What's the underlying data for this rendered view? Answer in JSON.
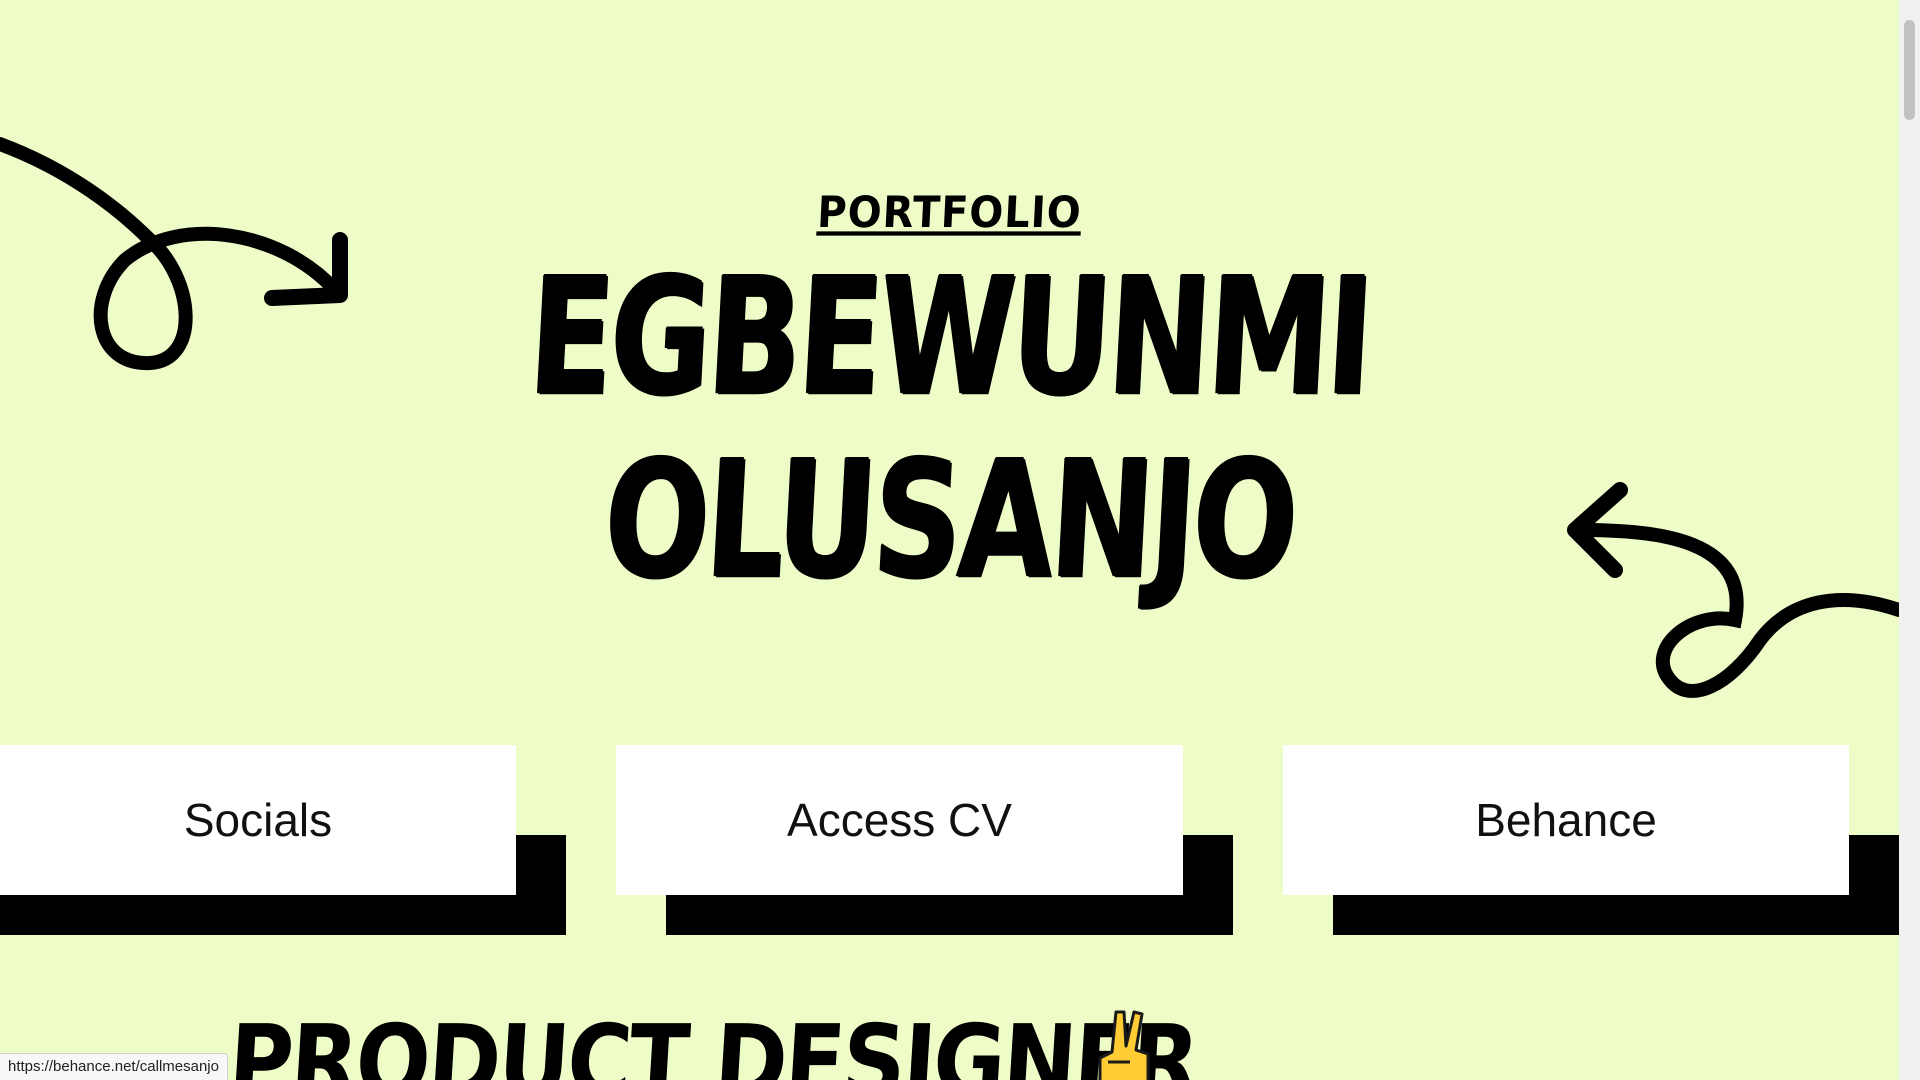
{
  "hero": {
    "kicker": "PORTFOLIO",
    "name_line_1": "EGBEWUNMI",
    "name_line_2": "OLUSANJO"
  },
  "buttons": [
    {
      "label": "Socials"
    },
    {
      "label": "Access CV"
    },
    {
      "label": "Behance"
    }
  ],
  "headline": {
    "text": "PRODUCT DESIGNER",
    "emoji_icon": "victory-hand-icon"
  },
  "status_bar": {
    "url": "https://behance.net/callmesanjo"
  },
  "colors": {
    "background": "#eefcc7",
    "button_face": "#ffffff",
    "button_shadow": "#000000",
    "ink": "#000000"
  }
}
